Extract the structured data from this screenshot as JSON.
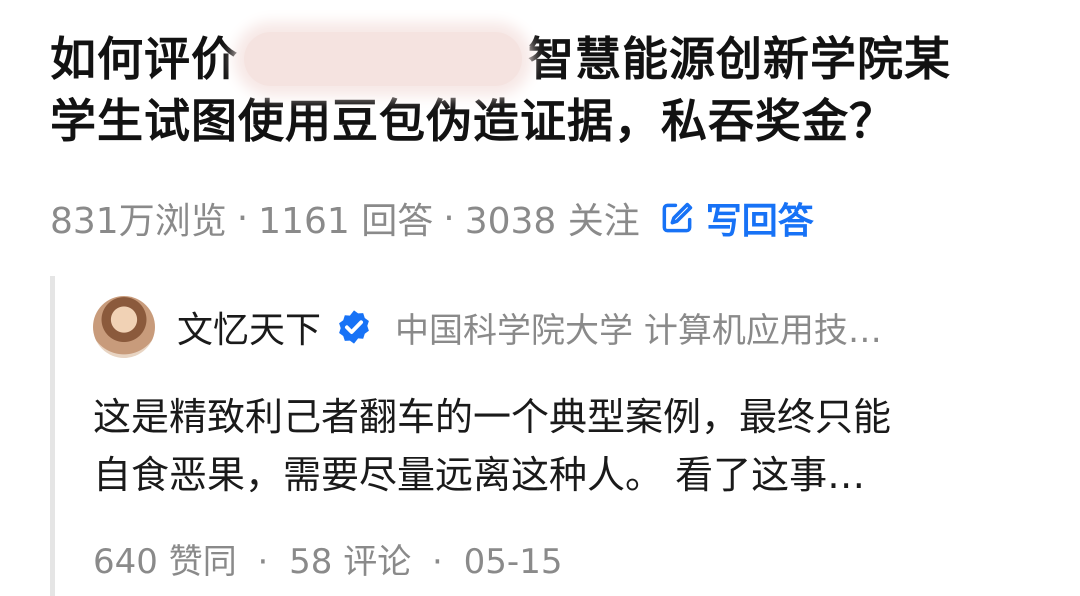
{
  "question": {
    "title_part1": "如何评价",
    "title_part2": "智慧能源创新学院某",
    "title_line2": "学生试图使用豆包伪造证据，私吞奖金？"
  },
  "stats": {
    "views": "831万浏览",
    "answers": "1161 回答",
    "followers": "3038 关注",
    "separator": "·",
    "write_answer_label": "写回答"
  },
  "answer": {
    "author_name": "文忆天下",
    "author_bio": "中国科学院大学 计算机应用技…",
    "excerpt_line1": "这是精致利己者翻车的一个典型案例，最终只能",
    "excerpt_line2": "自食恶果，需要尽量远离这种人。 看了这事…",
    "likes": "640 赞同",
    "comments": "58 评论",
    "date": "05-15"
  },
  "colors": {
    "accent": "#1772f6",
    "muted": "#8a8a8a",
    "title": "#121212"
  },
  "icons": {
    "write": "pencil-square-icon",
    "verified": "verified-badge-icon"
  }
}
